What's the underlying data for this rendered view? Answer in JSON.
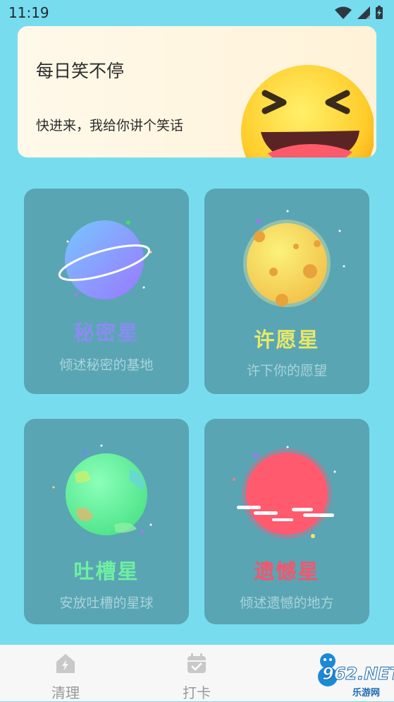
{
  "status_bar": {
    "time": "11:19"
  },
  "banner": {
    "title": "每日笑不停",
    "subtitle": "快进来，我给你讲个笑话"
  },
  "cards": [
    {
      "title": "秘密星",
      "desc": "倾述秘密的基地",
      "title_color": "#8a8cf0"
    },
    {
      "title": "许愿星",
      "desc": "许下你的愿望",
      "title_color": "#e7e86a"
    },
    {
      "title": "吐槽星",
      "desc": "安放吐槽的星球",
      "title_color": "#6ef0a2"
    },
    {
      "title": "遗憾星",
      "desc": "倾述遗憾的地方",
      "title_color": "#f2566e"
    }
  ],
  "nav": {
    "items": [
      {
        "label": "清理"
      },
      {
        "label": "打卡"
      }
    ]
  },
  "watermark": {
    "brand": "962.NET",
    "sub": "乐游网"
  }
}
